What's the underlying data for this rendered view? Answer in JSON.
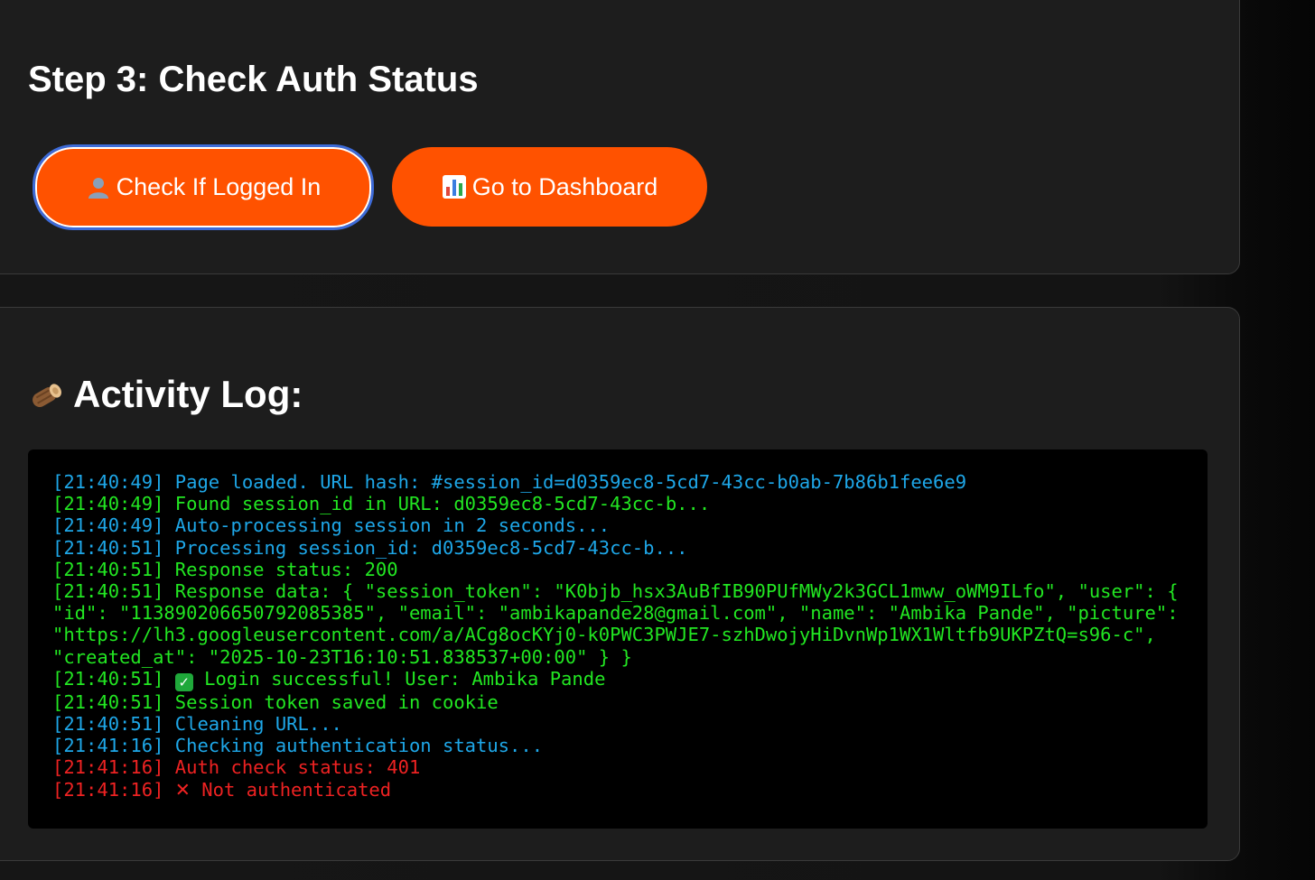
{
  "auth_section": {
    "title": "Step 3: Check Auth Status",
    "check_button": {
      "label": "Check If Logged In",
      "icon": "user-silhouette-icon"
    },
    "dashboard_button": {
      "label": "Go to Dashboard",
      "icon": "bar-chart-icon"
    }
  },
  "log_section": {
    "title": "Activity Log:",
    "icon": "log-wood-icon",
    "lines": [
      {
        "time": "[21:40:49]",
        "level": "info",
        "text": "Page loaded. URL hash: #session_id=d0359ec8-5cd7-43cc-b0ab-7b86b1fee6e9"
      },
      {
        "time": "[21:40:49]",
        "level": "success",
        "text": "Found session_id in URL: d0359ec8-5cd7-43cc-b..."
      },
      {
        "time": "[21:40:49]",
        "level": "info",
        "text": "Auto-processing session in 2 seconds..."
      },
      {
        "time": "[21:40:51]",
        "level": "info",
        "text": "Processing session_id: d0359ec8-5cd7-43cc-b..."
      },
      {
        "time": "[21:40:51]",
        "level": "success",
        "text": "Response status: 200"
      },
      {
        "time": "[21:40:51]",
        "level": "success",
        "text": "Response data: { \"session_token\": \"K0bjb_hsx3AuBfIB90PUfMWy2k3GCL1mww_oWM9ILfo\", \"user\": { \"id\": \"113890206650792085385\", \"email\": \"ambikapande28@gmail.com\", \"name\": \"Ambika Pande\", \"picture\": \"https://lh3.googleusercontent.com/a/ACg8ocKYj0-k0PWC3PWJE7-szhDwojyHiDvnWp1WX1Wltfb9UKPZtQ=s96-c\", \"created_at\": \"2025-10-23T16:10:51.838537+00:00\" } }"
      },
      {
        "time": "[21:40:51]",
        "level": "success",
        "prefix_icon": "check-mark-icon",
        "text": "Login successful! User: Ambika Pande"
      },
      {
        "time": "[21:40:51]",
        "level": "success",
        "text": "Session token saved in cookie"
      },
      {
        "time": "[21:40:51]",
        "level": "info",
        "text": "Cleaning URL..."
      },
      {
        "time": "[21:41:16]",
        "level": "info",
        "text": "Checking authentication status..."
      },
      {
        "time": "[21:41:16]",
        "level": "error",
        "text": "Auth check status: 401"
      },
      {
        "time": "[21:41:16]",
        "level": "error",
        "prefix_icon": "cross-mark-icon",
        "text": "Not authenticated"
      }
    ]
  },
  "colors": {
    "accent": "#ff5200",
    "log_info": "#1ea7e8",
    "log_success": "#22e622",
    "log_error": "#ee2222",
    "focus_ring": "#3d6bd8"
  }
}
